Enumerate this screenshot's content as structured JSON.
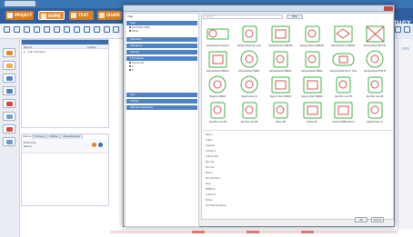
{
  "ribbon": {
    "tabs": [
      {
        "label": "PROJECT",
        "sub": "HOME",
        "color": "#e07a17"
      },
      {
        "label": "HOME"
      },
      {
        "label": "TEXT"
      },
      {
        "label": "SHAPE"
      }
    ],
    "brand": "PRODIGY"
  },
  "layers_panel": {
    "columns": [
      "Name",
      "Visible"
    ],
    "rows": [
      {
        "name": "Job Contents"
      }
    ]
  },
  "bottom_panel": {
    "tabs": [
      "Outline",
      "Contours",
      "Profiles",
      "Miscellaneous"
    ],
    "rows": [
      "Fullname",
      "Name"
    ]
  },
  "dialog": {
    "filter_label": "Filter",
    "sections": [
      {
        "label": "Type",
        "options": [
          "Goldmark Plate",
          "Other"
        ]
      },
      {
        "label": "Hardware"
      },
      {
        "label": "Clearance"
      },
      {
        "label": "Defined"
      },
      {
        "label": "Slot Details",
        "options": [
          "Horizontal",
          "A",
          "B"
        ]
      },
      {
        "label": "Size"
      },
      {
        "label": "Lookup"
      },
      {
        "label": "Standard Identified"
      }
    ],
    "search": {
      "placeholder": "Search",
      "button": "Filter"
    },
    "shapes": [
      "Rampartshell Symbol",
      "Rampartshell Lan Loch",
      "Rampartshell L/WBOXS",
      "Rampartshell L/WBOXS",
      "Rampartshell L/WBOXS",
      "Rampartshell INCH M",
      "Rampartshell WBOX-L",
      "Rampartshell WBOX",
      "Rampartshell WBOXL",
      "Rampartshell WBOX",
      "Rampartshell Slot in Oval",
      "Rampartshell FITB M",
      "Regions PRBXS",
      "Regions Round",
      "Regions Rect PRBXS",
      "Regions Rect PRBXS",
      "Red Box Low EB",
      "Red Box Low EB",
      "Red Box Low EB",
      "Red Box Low EB",
      "Rdbox RE",
      "Rdbox RE",
      "Default DEBOX Block",
      "Default Dark Lit"
    ],
    "properties": [
      "Name",
      "Folder",
      "Supplier",
      "Category",
      "Outline NO",
      "Bounds",
      "Bounds",
      "Model",
      "Part Number",
      "Ring",
      "BUNDLE",
      "Is Part #",
      "Notes",
      "Ext Dist Validation"
    ],
    "ok_label": "OK",
    "cancel_label": "Cancel"
  },
  "colors": {
    "accent": "#2d5e9f",
    "shape_green": "#3cb043",
    "shape_red": "#d9534f"
  }
}
